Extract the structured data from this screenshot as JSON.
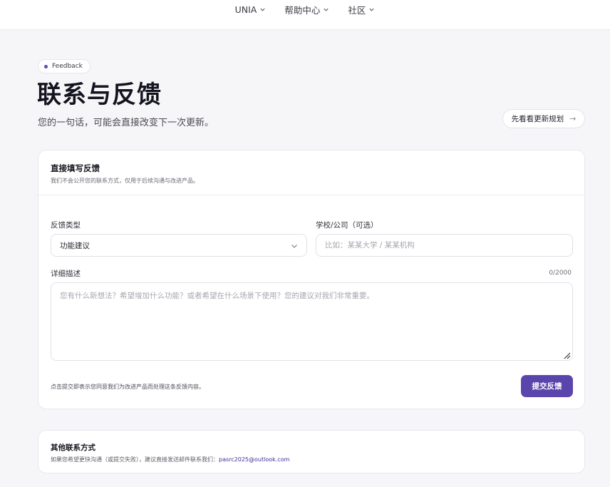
{
  "nav": {
    "items": [
      {
        "label": "UNIA"
      },
      {
        "label": "帮助中心"
      },
      {
        "label": "社区"
      }
    ]
  },
  "header": {
    "badge": "Feedback",
    "title": "联系与反馈",
    "subtitle": "您的一句话，可能会直接改变下一次更新。",
    "roadmap_button": "先看看更新规划",
    "roadmap_arrow": "→"
  },
  "form": {
    "title": "直接填写反馈",
    "description": "我们不会公开您的联系方式，仅用于后续沟通与改进产品。",
    "type_label": "反馈类型",
    "type_value": "功能建议",
    "org_label": "学校/公司（可选）",
    "org_placeholder": "比如：某某大学 / 某某机构",
    "detail_label": "详细描述",
    "counter": "0/2000",
    "detail_placeholder": "您有什么新想法？希望增加什么功能？或者希望在什么场景下使用？您的建议对我们非常重要。",
    "terms": "点击提交即表示您同意我们为改进产品而处理这条反馈内容。",
    "submit": "提交反馈"
  },
  "other": {
    "title": "其他联系方式",
    "text": "如果您希望更快沟通（或提交失败），建议直接发送邮件联系我们：",
    "email": "pasrc2025@outlook.com"
  },
  "colors": {
    "accent": "#5a45ad",
    "background": "#f6f6f8"
  }
}
